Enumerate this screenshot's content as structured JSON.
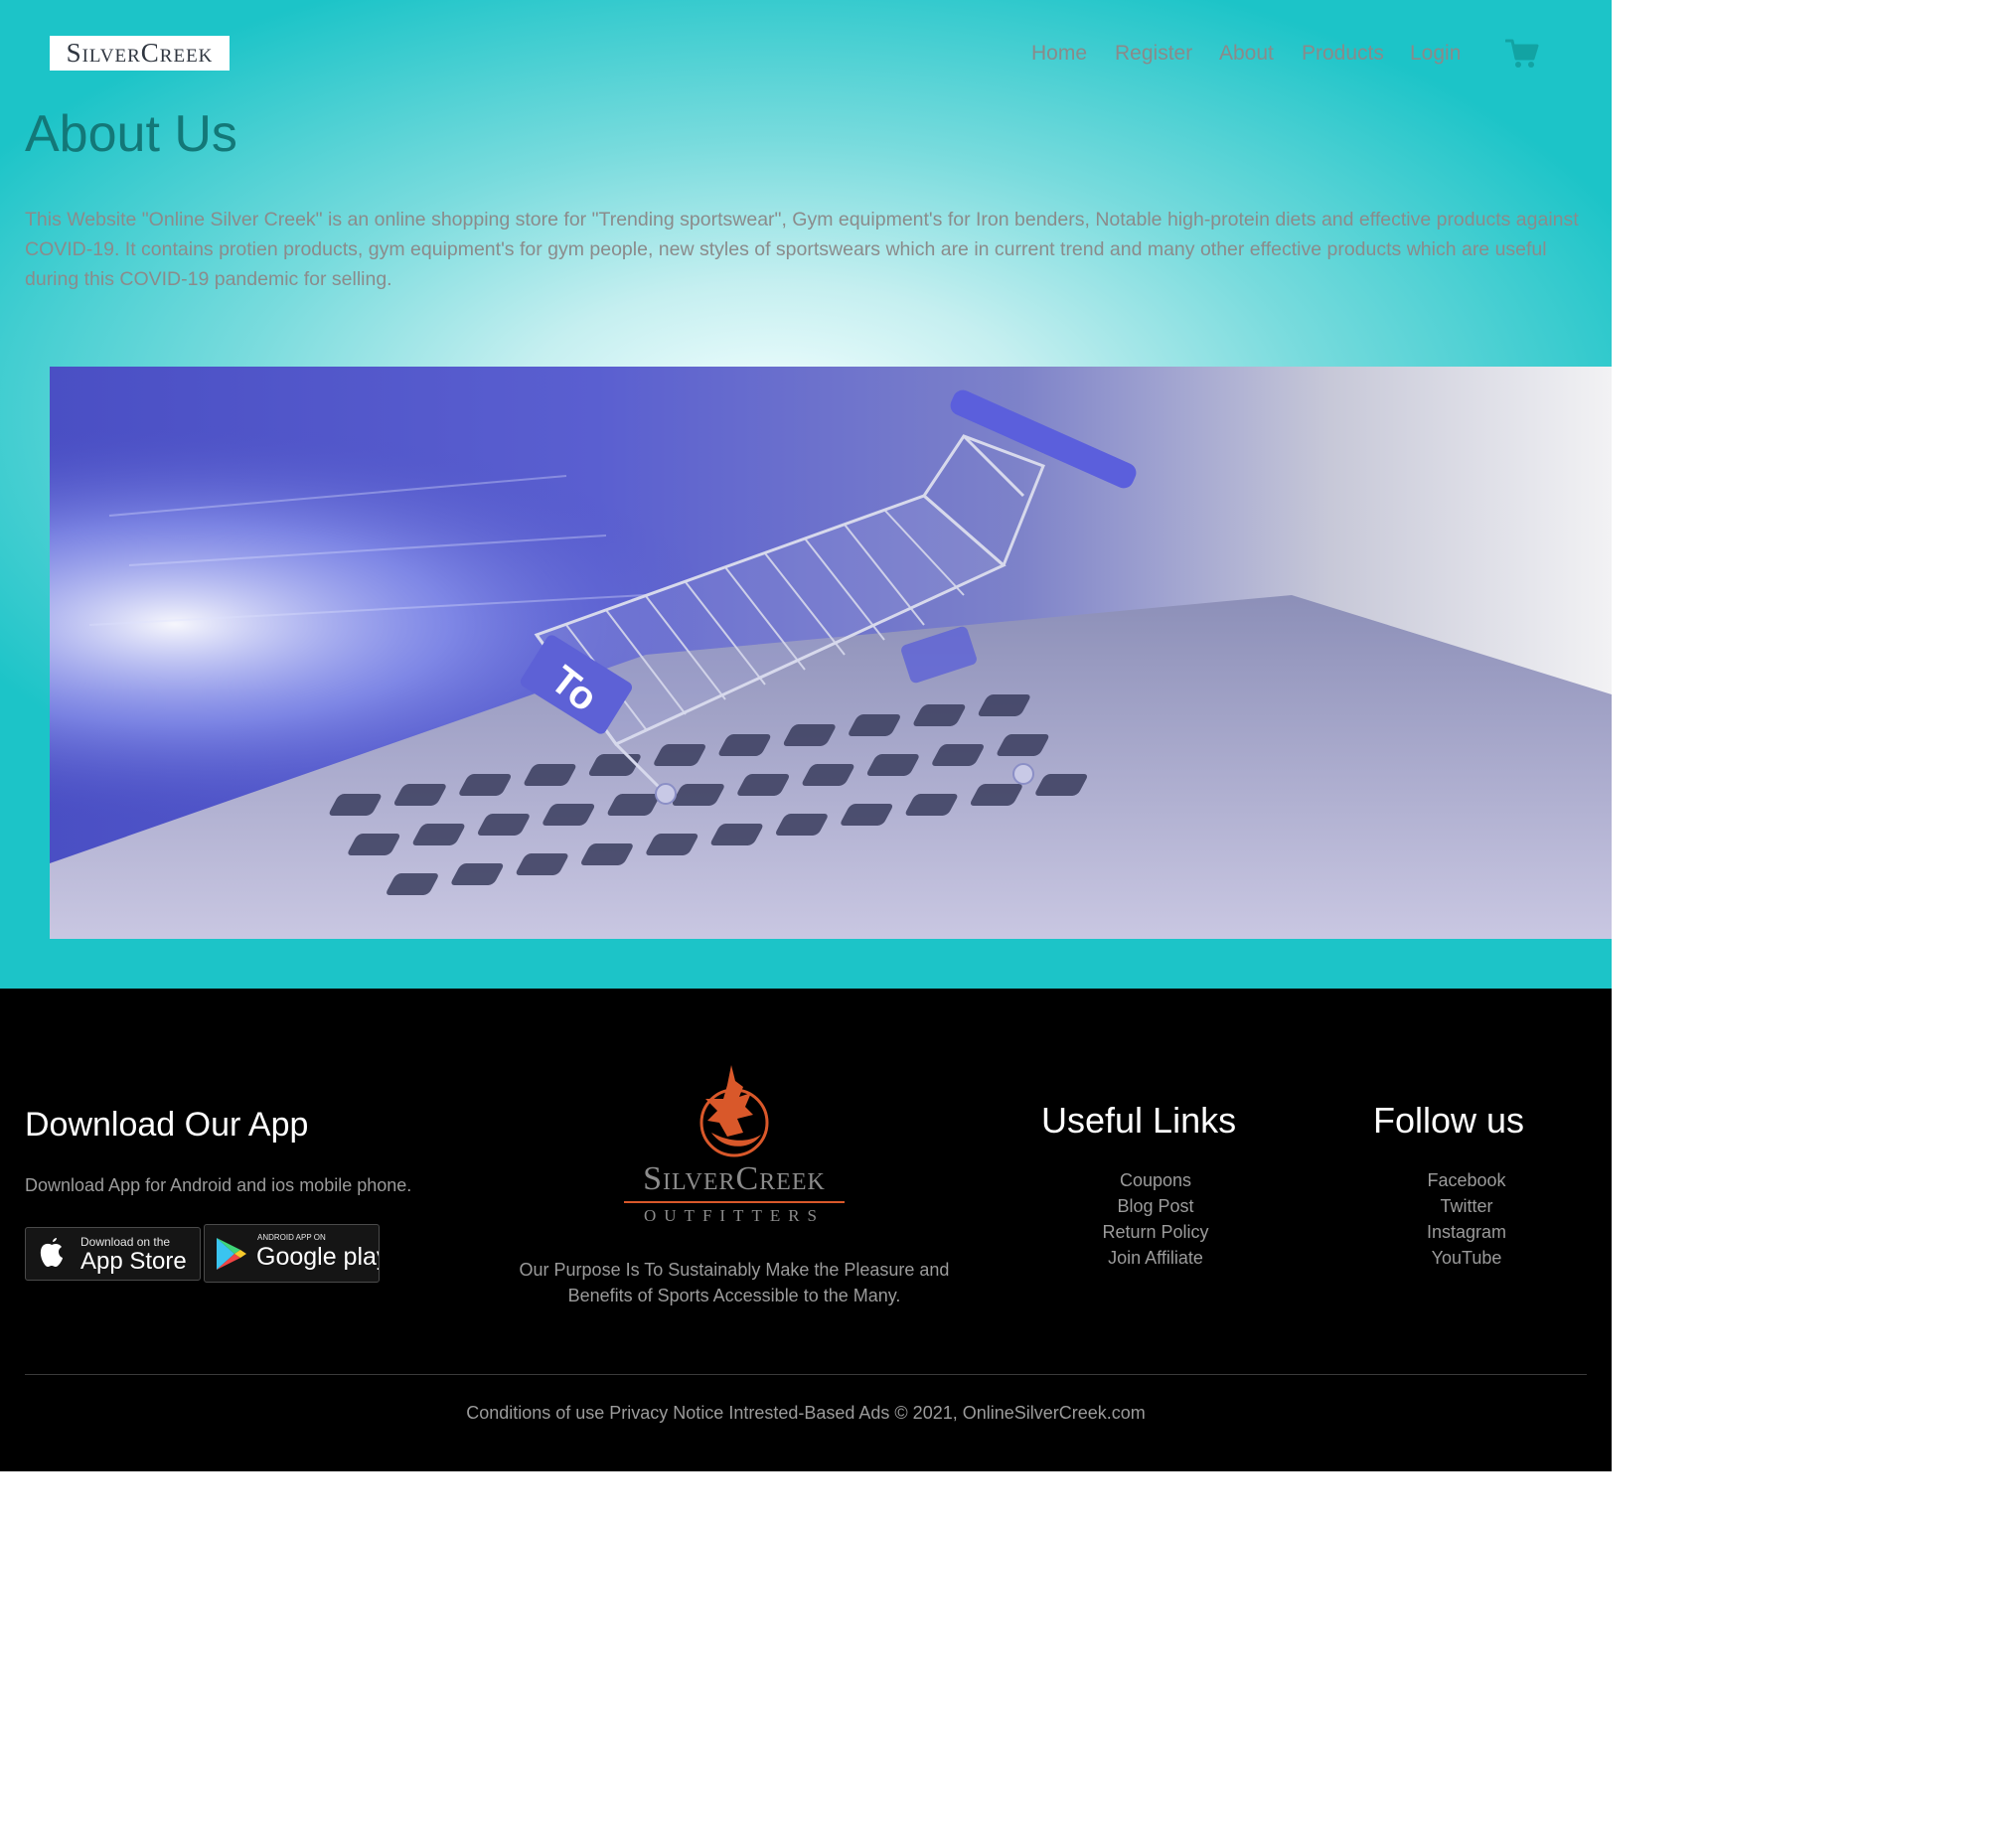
{
  "header": {
    "logo_text": "SilverCreek",
    "nav": [
      "Home",
      "Register",
      "About",
      "Products",
      "Login"
    ],
    "cart_icon": "shopping-cart-icon",
    "colors": {
      "nav_text": "#8a8a8a",
      "cart": "#12a3a3",
      "title": "#137878"
    }
  },
  "main": {
    "title": "About Us",
    "description": "This Website \"Online Silver Creek\" is an online shopping store for \"Trending sportswear\", Gym equipment's for Iron benders, Notable high-protein diets and effective products against COVID-19. It contains protien products, gym equipment's for gym people, new styles of sportswears which are in current trend and many other effective products which are useful during this COVID-19 pandemic for selling.",
    "banner_image": "shopping cart on laptop keyboard",
    "banner_cart_label": "To"
  },
  "footer": {
    "app": {
      "heading": "Download Our App",
      "text": "Download App for Android and ios mobile phone.",
      "appstore_small": "Download on the",
      "appstore_big": "App Store",
      "googleplay_small": "ANDROID APP ON",
      "googleplay_big": "Google play"
    },
    "brand": {
      "logo_name": "SilverCreek",
      "logo_sub": "OUTFITTERS",
      "tagline": "Our Purpose Is To Sustainably Make the Pleasure and Benefits of Sports Accessible to the Many."
    },
    "useful_links": {
      "heading": "Useful Links",
      "items": [
        "Coupons",
        "Blog Post",
        "Return Policy",
        "Join Affiliate"
      ]
    },
    "follow": {
      "heading": "Follow us",
      "items": [
        "Facebook",
        "Twitter",
        "Instagram",
        "YouTube"
      ]
    },
    "copyright": "Conditions of use Privacy Notice Intrested-Based Ads © 2021, OnlineSilverCreek.com"
  }
}
